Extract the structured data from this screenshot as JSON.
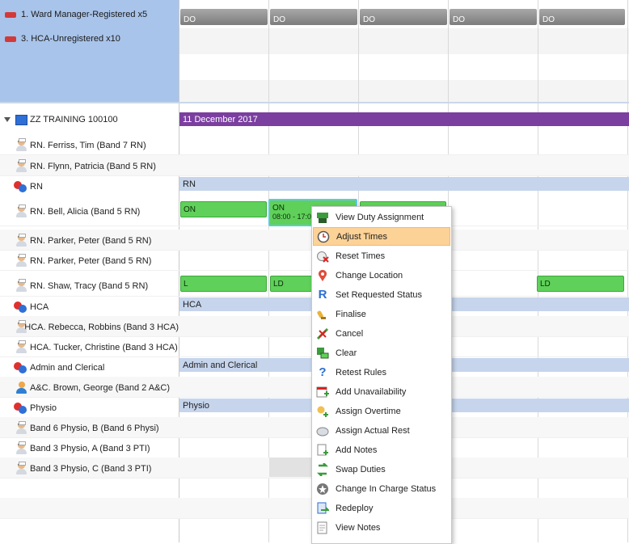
{
  "requirements": [
    {
      "label": "1. Ward Manager-Registered x5",
      "color": "#d23a3a"
    },
    {
      "label": "3. HCA-Unregistered x10",
      "color": "#d23a3a"
    }
  ],
  "duty_off_chips": [
    "DO",
    "DO",
    "DO",
    "DO",
    "DO"
  ],
  "ward": {
    "name": "ZZ TRAINING 100100",
    "date_bar": "11 December 2017",
    "date_bar_color": "#7b3fa0"
  },
  "rows": [
    {
      "label": "RN. Ferriss, Tim (Band 7 RN)",
      "kind": "person"
    },
    {
      "label": "RN. Flynn, Patricia (Band 5 RN)",
      "kind": "person"
    },
    {
      "label": "RN",
      "kind": "group"
    },
    {
      "label": "RN. Bell, Alicia (Band 5 RN)",
      "kind": "person"
    },
    {
      "label": "RN. Parker, Peter (Band 5 RN)",
      "kind": "person"
    },
    {
      "label": "RN. Parker, Peter (Band 5 RN)",
      "kind": "person"
    },
    {
      "label": "RN. Shaw, Tracy (Band 5 RN)",
      "kind": "person"
    },
    {
      "label": "HCA",
      "kind": "group"
    },
    {
      "label": "HCA. Rebecca, Robbins (Band 3 HCA)",
      "kind": "person"
    },
    {
      "label": "HCA. Tucker, Christine (Band 3 HCA)",
      "kind": "person"
    },
    {
      "label": "Admin and Clerical",
      "kind": "group"
    },
    {
      "label": "A&C. Brown, George (Band 2 A&C)",
      "kind": "single"
    },
    {
      "label": "Physio",
      "kind": "group"
    },
    {
      "label": "Band 6 Physio, B (Band 6 Physi)",
      "kind": "person"
    },
    {
      "label": "Band 3 Physio, A (Band 3 PTI)",
      "kind": "person"
    },
    {
      "label": "Band 3 Physio, C (Band 3 PTI)",
      "kind": "person"
    }
  ],
  "category_bars": {
    "rn": "RN",
    "hca": "HCA",
    "admin": "Admin and Clerical",
    "physio": "Physio"
  },
  "shifts": {
    "bell_1": "ON",
    "bell_2": "ON",
    "bell_2_time": "08:00 - 17:0",
    "shaw_1": "L",
    "shaw_2": "LD",
    "shaw_3": "LD"
  },
  "context_menu": [
    {
      "label": "View Duty Assignment",
      "icon": "duty-assignment-icon",
      "highlighted": false
    },
    {
      "label": "Adjust Times",
      "icon": "clock-icon",
      "highlighted": true
    },
    {
      "label": "Reset Times",
      "icon": "reset-icon",
      "highlighted": false
    },
    {
      "label": "Change Location",
      "icon": "location-pin-icon",
      "highlighted": false
    },
    {
      "label": "Set Requested Status",
      "icon": "requested-r-icon",
      "highlighted": false
    },
    {
      "label": "Finalise",
      "icon": "finalise-icon",
      "highlighted": false
    },
    {
      "label": "Cancel",
      "icon": "cancel-icon",
      "highlighted": false
    },
    {
      "label": "Clear",
      "icon": "clear-icon",
      "highlighted": false
    },
    {
      "label": "Retest Rules",
      "icon": "retest-icon",
      "highlighted": false
    },
    {
      "label": "Add Unavailability",
      "icon": "unavailability-icon",
      "highlighted": false
    },
    {
      "label": "Assign Overtime",
      "icon": "overtime-icon",
      "highlighted": false
    },
    {
      "label": "Assign Actual Rest",
      "icon": "rest-icon",
      "highlighted": false
    },
    {
      "label": "Add Notes",
      "icon": "add-notes-icon",
      "highlighted": false
    },
    {
      "label": "Swap Duties",
      "icon": "swap-icon",
      "highlighted": false
    },
    {
      "label": "Change In Charge Status",
      "icon": "star-icon",
      "highlighted": false
    },
    {
      "label": "Redeploy",
      "icon": "redeploy-icon",
      "highlighted": false
    },
    {
      "label": "View Notes",
      "icon": "view-notes-icon",
      "highlighted": false
    }
  ]
}
